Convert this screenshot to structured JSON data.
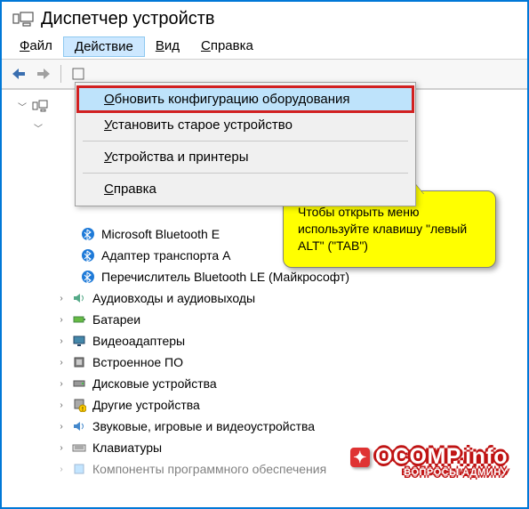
{
  "window": {
    "title": "Диспетчер устройств"
  },
  "menubar": {
    "items": [
      {
        "label": "Файл",
        "underline": 0
      },
      {
        "label": "Действие",
        "underline": 0,
        "active": true
      },
      {
        "label": "Вид",
        "underline": 0
      },
      {
        "label": "Справка",
        "underline": 0
      }
    ]
  },
  "dropdown": {
    "items": [
      {
        "label": "Обновить конфигурацию оборудования",
        "highlight": true
      },
      {
        "label": "Установить старое устройство"
      },
      {
        "sep": true
      },
      {
        "label": "Устройства и принтеры"
      },
      {
        "sep": true
      },
      {
        "label": "Справка"
      }
    ]
  },
  "tree": {
    "root": {
      "icon": "computer",
      "label": ""
    },
    "bluetooth_group": {
      "children": [
        {
          "icon": "bluetooth",
          "label": "Microsoft Bluetooth E"
        },
        {
          "icon": "bluetooth",
          "label": "Адаптер транспорта A"
        },
        {
          "icon": "bluetooth",
          "label": "Перечислитель Bluetooth LE (Майкрософт)"
        }
      ]
    },
    "categories": [
      {
        "icon": "audio",
        "label": "Аудиовходы и аудиовыходы"
      },
      {
        "icon": "battery",
        "label": "Батареи"
      },
      {
        "icon": "display",
        "label": "Видеоадаптеры"
      },
      {
        "icon": "firmware",
        "label": "Встроенное ПО"
      },
      {
        "icon": "disk",
        "label": "Дисковые устройства"
      },
      {
        "icon": "other",
        "label": "Другие устройства"
      },
      {
        "icon": "sound",
        "label": "Звуковые, игровые и видеоустройства"
      },
      {
        "icon": "keyboard",
        "label": "Клавиатуры"
      },
      {
        "icon": "software",
        "label": "Компоненты программного обеспечения"
      }
    ]
  },
  "callout": {
    "text": "Чтобы открыть меню используйте клавишу \"левый ALT\" (\"TAB\")"
  },
  "watermark": {
    "main": "OCOMP.info",
    "sub": "ВОПРОСЫ АДМИНУ"
  },
  "colors": {
    "border": "#0078d7",
    "highlight_bg": "#bee3fb",
    "highlight_outline": "#d22020",
    "callout_bg": "#ffff00"
  }
}
